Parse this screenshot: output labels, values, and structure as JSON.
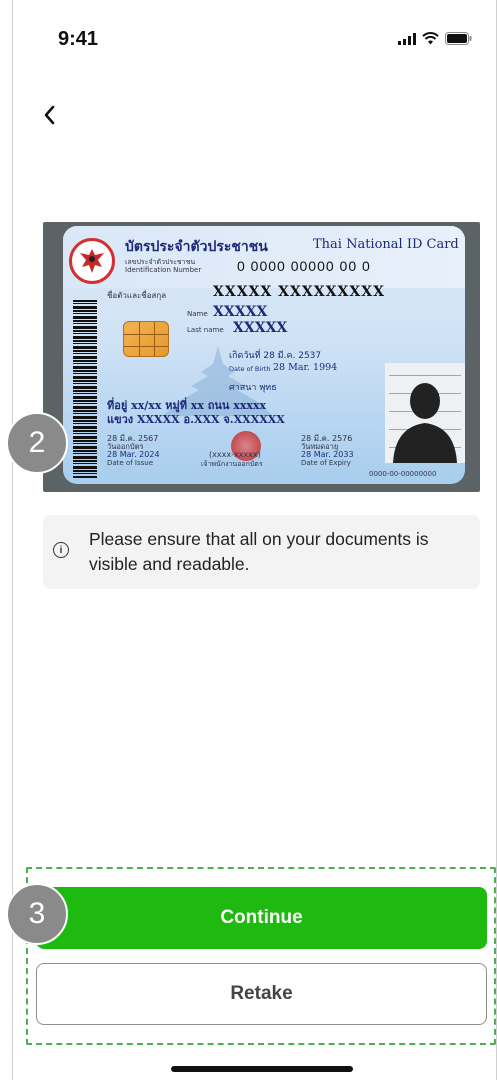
{
  "status_bar": {
    "time": "9:41"
  },
  "icons": {
    "back": "chevron-left-icon",
    "info": "info-icon",
    "signal": "signal-icon",
    "wifi": "wifi-icon",
    "battery": "battery-icon"
  },
  "id_card": {
    "title_th": "บัตรประจำตัวประชาชน",
    "title_en": "Thai National ID Card",
    "id_label_th": "เลขประจำตัวประชาชน",
    "id_label_en": "Identification Number",
    "id_number": "0 0000 00000 00 0",
    "name_label_th": "ชื่อตัวและชื่อสกุล",
    "name_th": "XXXXX  XXXXXXXXX",
    "name_en_label": "Name",
    "name_en": "XXXXX",
    "lastname_label": "Last name",
    "lastname_en": "XXXXX",
    "dob_th": "เกิดวันที่ 28 มี.ค. 2537",
    "dob_en_label": "Date of Birth",
    "dob_en": "28 Mar. 1994",
    "religion": "ศาสนา พุทธ",
    "address_line1": "ที่อยู่ xx/xx หมู่ที่ xx ถนน xxxxx",
    "address_line2": "แขวง XXXXX อ.XXX จ.XXXXXX",
    "issue_th": "28 มี.ค. 2567",
    "issue_label_th": "วันออกบัตร",
    "issue_en": "28 Mar. 2024",
    "issue_label_en": "Date of Issue",
    "officer": "(xxxx-xxxxx)",
    "officer_label": "เจ้าพนักงานออกบัตร",
    "expiry_th": "28 มี.ค. 2576",
    "expiry_label_th": "วันหมดอายุ",
    "expiry_en": "28 Mar. 2033",
    "expiry_label_en": "Date of Expiry",
    "photo_code": "0000-00-00000000"
  },
  "annotations": {
    "badge_2": "2",
    "badge_3": "3"
  },
  "notice": {
    "text": "Please ensure that all on your documents is visible and readable."
  },
  "buttons": {
    "continue": "Continue",
    "retake": "Retake"
  },
  "colors": {
    "primary": "#1fba0f",
    "dashed_outline": "#4caf50"
  }
}
